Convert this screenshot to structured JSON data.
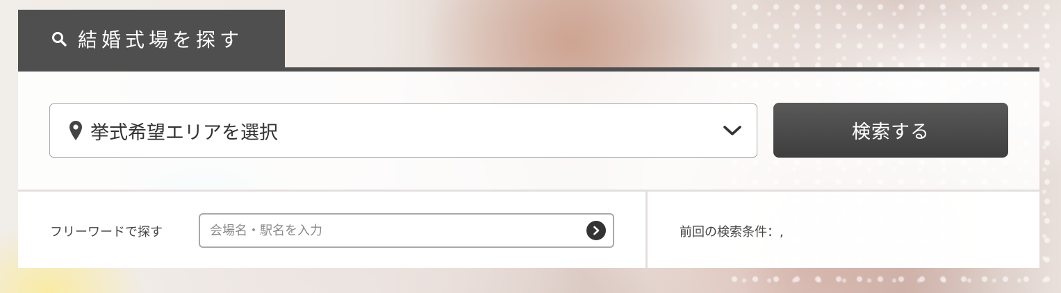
{
  "tab": {
    "label": "結婚式場を探す",
    "icon": "search-icon"
  },
  "area_select": {
    "icon": "map-pin-icon",
    "selected_text": "挙式希望エリアを選択",
    "dropdown_icon": "chevron-down-icon"
  },
  "search_button": {
    "label": "検索する"
  },
  "freeword": {
    "label": "フリーワードで探す",
    "placeholder": "会場名・駅名を入力",
    "value": "",
    "submit_icon": "chevron-right-circle-icon"
  },
  "last_search": {
    "label": "前回の検索条件：,"
  },
  "colors": {
    "tab_bg": "#4f4f4f",
    "button_bg": "#454545",
    "text": "#333333",
    "border": "#a9a9a9"
  }
}
